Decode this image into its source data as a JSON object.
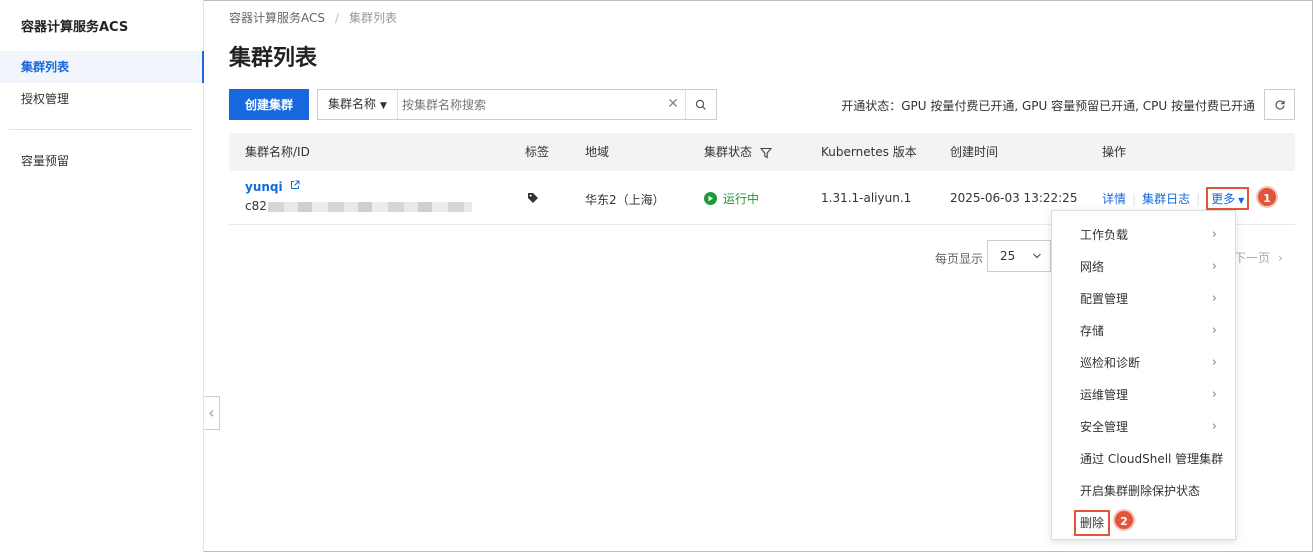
{
  "sidebar": {
    "title": "容器计算服务ACS",
    "items": [
      {
        "label": "集群列表"
      },
      {
        "label": "授权管理"
      },
      {
        "label": "容量预留"
      }
    ]
  },
  "breadcrumb": {
    "root": "容器计算服务ACS",
    "separator": "/",
    "current": "集群列表"
  },
  "page": {
    "title": "集群列表"
  },
  "toolbar": {
    "create_label": "创建集群",
    "search_field_label": "集群名称",
    "search_placeholder": "按集群名称搜索",
    "status_text": "开通状态：GPU 按量付费已开通, GPU 容量预留已开通, CPU 按量付费已开通"
  },
  "table": {
    "columns": [
      "集群名称/ID",
      "标签",
      "地域",
      "集群状态",
      "Kubernetes 版本",
      "创建时间",
      "操作"
    ],
    "rows": [
      {
        "name": "yunqi",
        "id_prefix": "c82",
        "region": "华东2（上海）",
        "status": "运行中",
        "version": "1.31.1-aliyun.1",
        "created": "2025-06-03 13:22:25",
        "actions": {
          "details": "详情",
          "logs": "集群日志",
          "more": "更多"
        }
      }
    ]
  },
  "pagination": {
    "per_page_label": "每页显示",
    "page_size": "25",
    "next_label": "下一页"
  },
  "more_menu": {
    "items": [
      {
        "label": "工作负载",
        "submenu": true
      },
      {
        "label": "网络",
        "submenu": true
      },
      {
        "label": "配置管理",
        "submenu": true
      },
      {
        "label": "存储",
        "submenu": true
      },
      {
        "label": "巡检和诊断",
        "submenu": true
      },
      {
        "label": "运维管理",
        "submenu": true
      },
      {
        "label": "安全管理",
        "submenu": true
      },
      {
        "label": "通过 CloudShell 管理集群",
        "submenu": false
      },
      {
        "label": "开启集群删除保护状态",
        "submenu": false
      },
      {
        "label": "删除",
        "submenu": false
      }
    ]
  },
  "annotations": {
    "step1": "1",
    "step2": "2"
  },
  "colors": {
    "primary": "#1668dc",
    "running": "#1a9a3a",
    "highlight": "#e2553a"
  }
}
